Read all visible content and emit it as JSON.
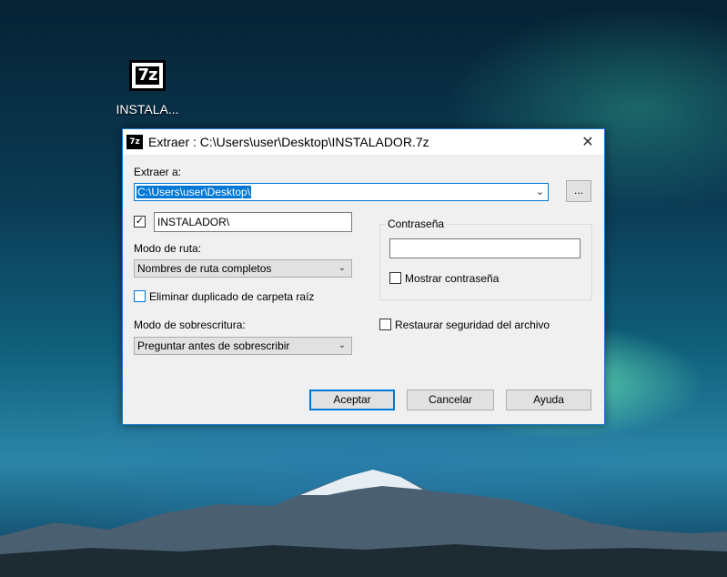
{
  "desktop": {
    "icon_label": "INSTALA...",
    "icon_glyph": "7z"
  },
  "dialog": {
    "title": "Extraer : C:\\Users\\user\\Desktop\\INSTALADOR.7z",
    "title_icon": "7z",
    "close_glyph": "✕",
    "extract_to_label": "Extraer a:",
    "extract_to_value": "C:\\Users\\user\\Desktop\\",
    "browse_label": "...",
    "folder_checkbox_checked": true,
    "folder_name_value": "INSTALADOR\\",
    "path_mode_label": "Modo de ruta:",
    "path_mode_value": "Nombres de ruta completos",
    "remove_dup_label": "Eliminar duplicado de carpeta raíz",
    "overwrite_mode_label": "Modo de sobrescritura:",
    "overwrite_mode_value": "Preguntar antes de sobrescribir",
    "password_group_label": "Contraseña",
    "password_value": "",
    "show_password_label": "Mostrar contraseña",
    "restore_security_label": "Restaurar seguridad del archivo",
    "ok_label": "Aceptar",
    "cancel_label": "Cancelar",
    "help_label": "Ayuda"
  },
  "colors": {
    "accent": "#0078d7",
    "dialog_bg": "#f0f0f0"
  }
}
